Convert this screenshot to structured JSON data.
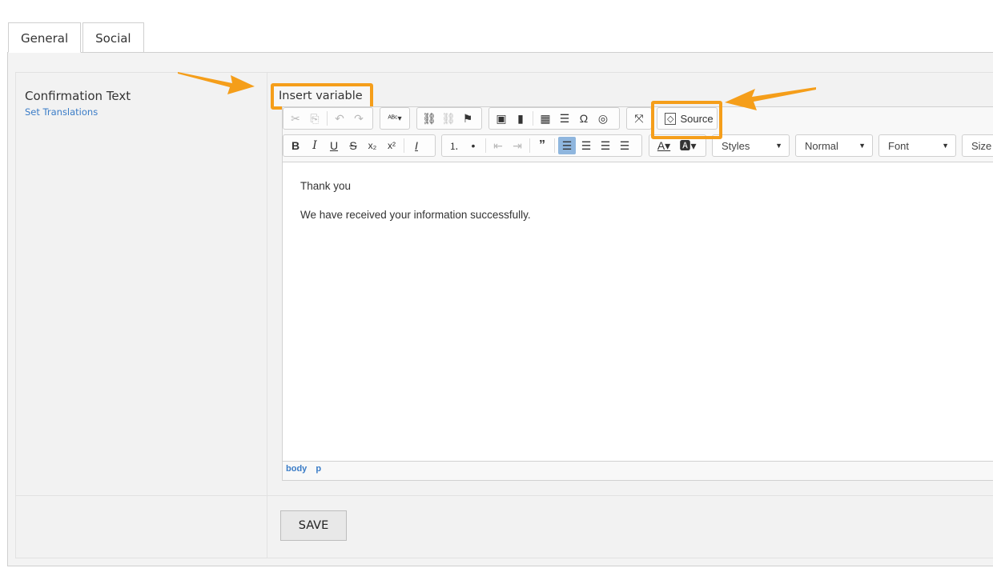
{
  "tabs": [
    {
      "label": "General",
      "active": true
    },
    {
      "label": "Social",
      "active": false
    }
  ],
  "field": {
    "label": "Confirmation Text",
    "translations_link": "Set Translations"
  },
  "insert_variable": {
    "label": "Insert variable"
  },
  "toolbar": {
    "source_label": "Source",
    "combos": {
      "styles": "Styles",
      "format": "Normal",
      "font": "Font",
      "size": "Size"
    }
  },
  "editor": {
    "paragraphs": [
      "Thank you",
      "We have received your information successfully."
    ],
    "path": [
      "body",
      "p"
    ]
  },
  "actions": {
    "save_label": "SAVE"
  },
  "colors": {
    "accent_orange": "#f59e1a",
    "link_blue": "#3a7cc7"
  },
  "icons": [
    "cut-icon",
    "copy-icon",
    "undo-icon",
    "redo-icon",
    "spellcheck-icon",
    "link-icon",
    "unlink-icon",
    "anchor-icon",
    "image-icon",
    "flash-icon",
    "table-icon",
    "horizontal-rule-icon",
    "special-char-icon",
    "iframe-icon",
    "maximize-icon",
    "source-icon",
    "bold-icon",
    "italic-icon",
    "underline-icon",
    "strike-icon",
    "subscript-icon",
    "superscript-icon",
    "remove-format-icon",
    "numbered-list-icon",
    "bulleted-list-icon",
    "outdent-icon",
    "indent-icon",
    "blockquote-icon",
    "align-left-icon",
    "align-center-icon",
    "align-right-icon",
    "justify-icon",
    "text-color-icon",
    "bg-color-icon"
  ]
}
